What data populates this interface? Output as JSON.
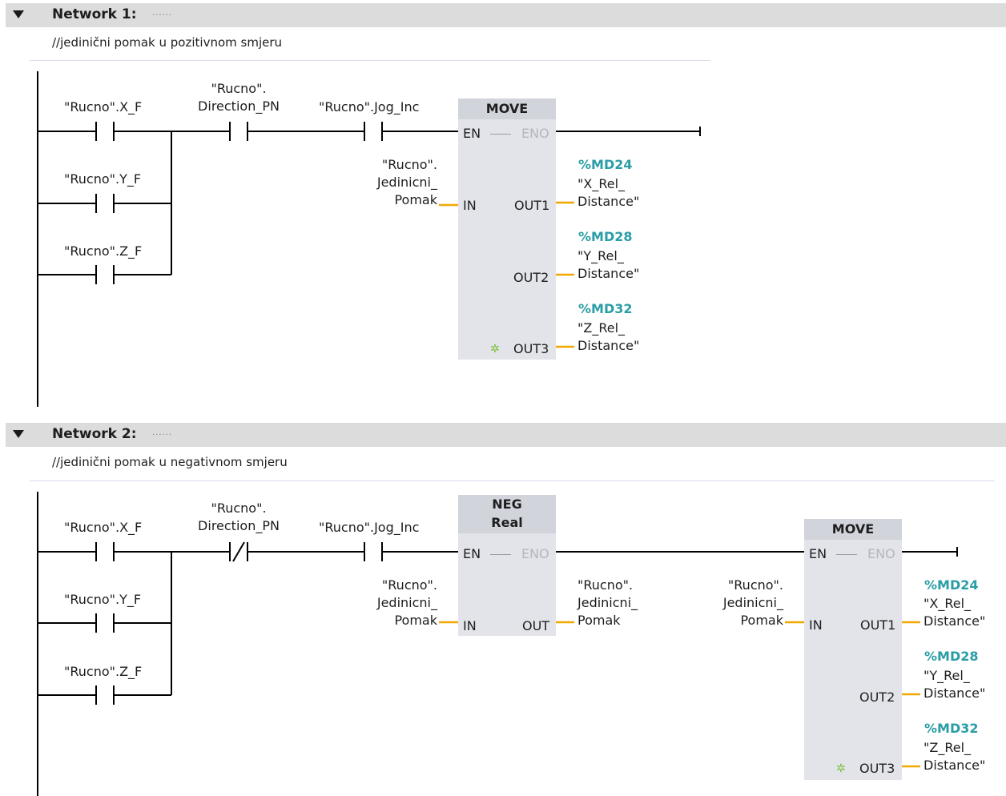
{
  "network1": {
    "title": "Network 1:",
    "dots": "......",
    "comment": "//jedinični pomak u pozitivnom smjeru",
    "contacts": {
      "x_f": "\"Rucno\".X_F",
      "y_f": "\"Rucno\".Y_F",
      "z_f": "\"Rucno\".Z_F",
      "direction_line1": "\"Rucno\".",
      "direction_line2": "Direction_PN",
      "jog_inc": "\"Rucno\".Jog_Inc"
    },
    "move": {
      "name": "MOVE",
      "en": "EN",
      "eno": "ENO",
      "in_pin": "IN",
      "in_operand": [
        "\"Rucno\".",
        "Jedinicni_",
        "Pomak"
      ],
      "outputs": [
        {
          "pin": "OUT1",
          "address": "%MD24",
          "operand_line1": "\"X_Rel_",
          "operand_line2": "Distance\""
        },
        {
          "pin": "OUT2",
          "address": "%MD28",
          "operand_line1": "\"Y_Rel_",
          "operand_line2": "Distance\""
        },
        {
          "pin": "OUT3",
          "address": "%MD32",
          "operand_line1": "\"Z_Rel_",
          "operand_line2": "Distance\""
        }
      ]
    }
  },
  "network2": {
    "title": "Network 2:",
    "dots": "......",
    "comment": "//jedinični pomak u negativnom smjeru",
    "contacts": {
      "x_f": "\"Rucno\".X_F",
      "y_f": "\"Rucno\".Y_F",
      "z_f": "\"Rucno\".Z_F",
      "direction_line1": "\"Rucno\".",
      "direction_line2": "Direction_PN",
      "jog_inc": "\"Rucno\".Jog_Inc"
    },
    "neg": {
      "name": "NEG",
      "type": "Real",
      "en": "EN",
      "eno": "ENO",
      "in_pin": "IN",
      "out_pin": "OUT",
      "in_operand": [
        "\"Rucno\".",
        "Jedinicni_",
        "Pomak"
      ],
      "out_operand": [
        "\"Rucno\".",
        "Jedinicni_",
        "Pomak"
      ]
    },
    "move": {
      "name": "MOVE",
      "en": "EN",
      "eno": "ENO",
      "in_pin": "IN",
      "in_operand": [
        "\"Rucno\".",
        "Jedinicni_",
        "Pomak"
      ],
      "outputs": [
        {
          "pin": "OUT1",
          "address": "%MD24",
          "operand_line1": "\"X_Rel_",
          "operand_line2": "Distance\""
        },
        {
          "pin": "OUT2",
          "address": "%MD28",
          "operand_line1": "\"Y_Rel_",
          "operand_line2": "Distance\""
        },
        {
          "pin": "OUT3",
          "address": "%MD32",
          "operand_line1": "\"Z_Rel_",
          "operand_line2": "Distance\""
        }
      ]
    }
  },
  "colors": {
    "wire": "#000000",
    "operand_wire": "#f0a800",
    "address": "#2a9da6",
    "block": "#e3e4ea",
    "header": "#dcdcdc"
  },
  "icons": {
    "collapse": "triangle-down-icon",
    "add_output": "star-icon"
  }
}
